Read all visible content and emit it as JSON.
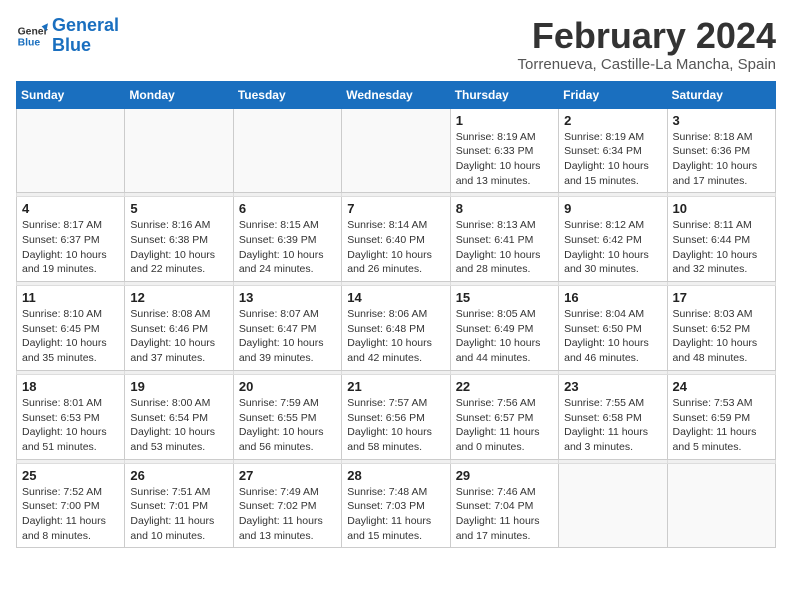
{
  "header": {
    "logo_general": "General",
    "logo_blue": "Blue",
    "title": "February 2024",
    "subtitle": "Torrenueva, Castille-La Mancha, Spain"
  },
  "weekdays": [
    "Sunday",
    "Monday",
    "Tuesday",
    "Wednesday",
    "Thursday",
    "Friday",
    "Saturday"
  ],
  "weeks": [
    [
      {
        "day": "",
        "info": ""
      },
      {
        "day": "",
        "info": ""
      },
      {
        "day": "",
        "info": ""
      },
      {
        "day": "",
        "info": ""
      },
      {
        "day": "1",
        "info": "Sunrise: 8:19 AM\nSunset: 6:33 PM\nDaylight: 10 hours\nand 13 minutes."
      },
      {
        "day": "2",
        "info": "Sunrise: 8:19 AM\nSunset: 6:34 PM\nDaylight: 10 hours\nand 15 minutes."
      },
      {
        "day": "3",
        "info": "Sunrise: 8:18 AM\nSunset: 6:36 PM\nDaylight: 10 hours\nand 17 minutes."
      }
    ],
    [
      {
        "day": "4",
        "info": "Sunrise: 8:17 AM\nSunset: 6:37 PM\nDaylight: 10 hours\nand 19 minutes."
      },
      {
        "day": "5",
        "info": "Sunrise: 8:16 AM\nSunset: 6:38 PM\nDaylight: 10 hours\nand 22 minutes."
      },
      {
        "day": "6",
        "info": "Sunrise: 8:15 AM\nSunset: 6:39 PM\nDaylight: 10 hours\nand 24 minutes."
      },
      {
        "day": "7",
        "info": "Sunrise: 8:14 AM\nSunset: 6:40 PM\nDaylight: 10 hours\nand 26 minutes."
      },
      {
        "day": "8",
        "info": "Sunrise: 8:13 AM\nSunset: 6:41 PM\nDaylight: 10 hours\nand 28 minutes."
      },
      {
        "day": "9",
        "info": "Sunrise: 8:12 AM\nSunset: 6:42 PM\nDaylight: 10 hours\nand 30 minutes."
      },
      {
        "day": "10",
        "info": "Sunrise: 8:11 AM\nSunset: 6:44 PM\nDaylight: 10 hours\nand 32 minutes."
      }
    ],
    [
      {
        "day": "11",
        "info": "Sunrise: 8:10 AM\nSunset: 6:45 PM\nDaylight: 10 hours\nand 35 minutes."
      },
      {
        "day": "12",
        "info": "Sunrise: 8:08 AM\nSunset: 6:46 PM\nDaylight: 10 hours\nand 37 minutes."
      },
      {
        "day": "13",
        "info": "Sunrise: 8:07 AM\nSunset: 6:47 PM\nDaylight: 10 hours\nand 39 minutes."
      },
      {
        "day": "14",
        "info": "Sunrise: 8:06 AM\nSunset: 6:48 PM\nDaylight: 10 hours\nand 42 minutes."
      },
      {
        "day": "15",
        "info": "Sunrise: 8:05 AM\nSunset: 6:49 PM\nDaylight: 10 hours\nand 44 minutes."
      },
      {
        "day": "16",
        "info": "Sunrise: 8:04 AM\nSunset: 6:50 PM\nDaylight: 10 hours\nand 46 minutes."
      },
      {
        "day": "17",
        "info": "Sunrise: 8:03 AM\nSunset: 6:52 PM\nDaylight: 10 hours\nand 48 minutes."
      }
    ],
    [
      {
        "day": "18",
        "info": "Sunrise: 8:01 AM\nSunset: 6:53 PM\nDaylight: 10 hours\nand 51 minutes."
      },
      {
        "day": "19",
        "info": "Sunrise: 8:00 AM\nSunset: 6:54 PM\nDaylight: 10 hours\nand 53 minutes."
      },
      {
        "day": "20",
        "info": "Sunrise: 7:59 AM\nSunset: 6:55 PM\nDaylight: 10 hours\nand 56 minutes."
      },
      {
        "day": "21",
        "info": "Sunrise: 7:57 AM\nSunset: 6:56 PM\nDaylight: 10 hours\nand 58 minutes."
      },
      {
        "day": "22",
        "info": "Sunrise: 7:56 AM\nSunset: 6:57 PM\nDaylight: 11 hours\nand 0 minutes."
      },
      {
        "day": "23",
        "info": "Sunrise: 7:55 AM\nSunset: 6:58 PM\nDaylight: 11 hours\nand 3 minutes."
      },
      {
        "day": "24",
        "info": "Sunrise: 7:53 AM\nSunset: 6:59 PM\nDaylight: 11 hours\nand 5 minutes."
      }
    ],
    [
      {
        "day": "25",
        "info": "Sunrise: 7:52 AM\nSunset: 7:00 PM\nDaylight: 11 hours\nand 8 minutes."
      },
      {
        "day": "26",
        "info": "Sunrise: 7:51 AM\nSunset: 7:01 PM\nDaylight: 11 hours\nand 10 minutes."
      },
      {
        "day": "27",
        "info": "Sunrise: 7:49 AM\nSunset: 7:02 PM\nDaylight: 11 hours\nand 13 minutes."
      },
      {
        "day": "28",
        "info": "Sunrise: 7:48 AM\nSunset: 7:03 PM\nDaylight: 11 hours\nand 15 minutes."
      },
      {
        "day": "29",
        "info": "Sunrise: 7:46 AM\nSunset: 7:04 PM\nDaylight: 11 hours\nand 17 minutes."
      },
      {
        "day": "",
        "info": ""
      },
      {
        "day": "",
        "info": ""
      }
    ]
  ]
}
